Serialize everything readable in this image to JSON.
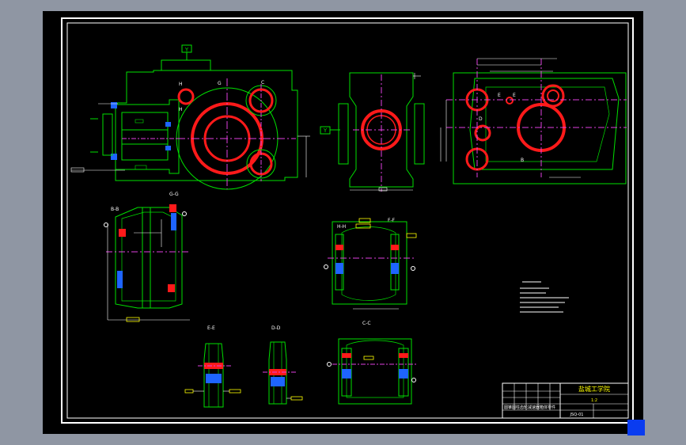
{
  "colors": {
    "background": "#8f96a3",
    "paper": "#000000",
    "frame": "#ffffff",
    "part_lines": "#00e000",
    "bearing_bores": "#ff1a1a",
    "centerlines": "#e040e0",
    "dimensions": "#ffffff",
    "callouts": "#ffff00",
    "cyan_marks": "#00e5e5",
    "blue_marks": "#1e64ff",
    "corner_block": "#0a3cf0"
  },
  "views": {
    "main": {
      "label_y": "Y",
      "marks": [
        "H",
        "G",
        "C",
        "H"
      ]
    },
    "side": {
      "label_y": "Y"
    },
    "top": {
      "marks": [
        "E",
        "E",
        "D",
        "B"
      ]
    }
  },
  "sections": {
    "bb": "B-B",
    "gg": "G-G",
    "hh": "H-H",
    "ff": "F-F",
    "ee": "E-E",
    "dd": "D-D",
    "cc": "C-C"
  },
  "title_block": {
    "school": "盐城工学院",
    "scale": "1:2",
    "drawing_name": "圆锥圆柱齿轮减速器箱体零件",
    "drawing_number": "JSQ-01"
  }
}
